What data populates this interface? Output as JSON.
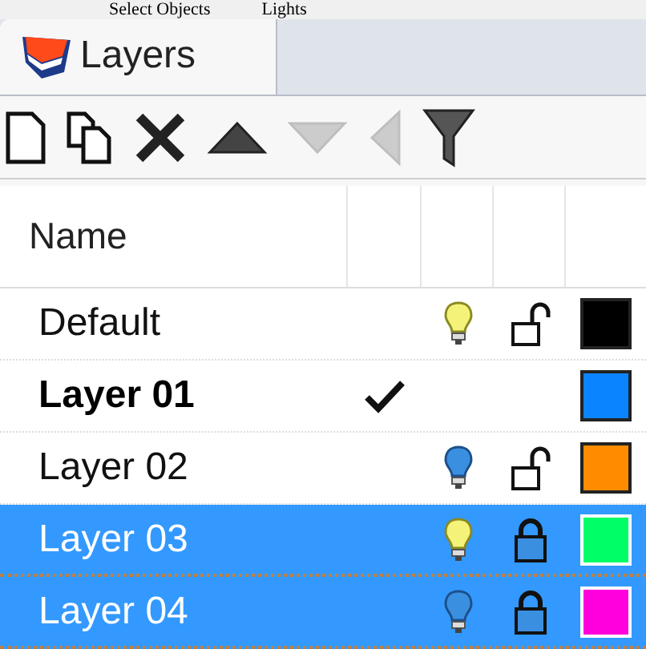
{
  "top_bar": {
    "items": [
      "Select Objects",
      "Lights"
    ]
  },
  "tab": {
    "label": "Layers",
    "selected": true
  },
  "toolbar": {
    "buttons": [
      {
        "kind": "new",
        "disabled": false
      },
      {
        "kind": "copy",
        "disabled": false
      },
      {
        "kind": "delete",
        "disabled": false
      },
      {
        "kind": "up",
        "disabled": false
      },
      {
        "kind": "down",
        "disabled": true
      },
      {
        "kind": "left",
        "disabled": true
      },
      {
        "kind": "filter",
        "disabled": false
      }
    ]
  },
  "table": {
    "columns": [
      "Name"
    ],
    "rows": [
      {
        "name": "Default",
        "current": false,
        "light_on": true,
        "locked": false,
        "color": "#000000",
        "selected": false
      },
      {
        "name": "Layer 01",
        "current": true,
        "color": "#0a84ff",
        "selected": false
      },
      {
        "name": "Layer 02",
        "current": false,
        "light_on": false,
        "locked": false,
        "color": "#ff8c00",
        "selected": false
      },
      {
        "name": "Layer 03",
        "current": false,
        "light_on": true,
        "locked": true,
        "color": "#00ff66",
        "selected": true
      },
      {
        "name": "Layer 04",
        "current": false,
        "light_on": false,
        "locked": true,
        "color": "#ff00dd",
        "selected": true
      }
    ]
  }
}
